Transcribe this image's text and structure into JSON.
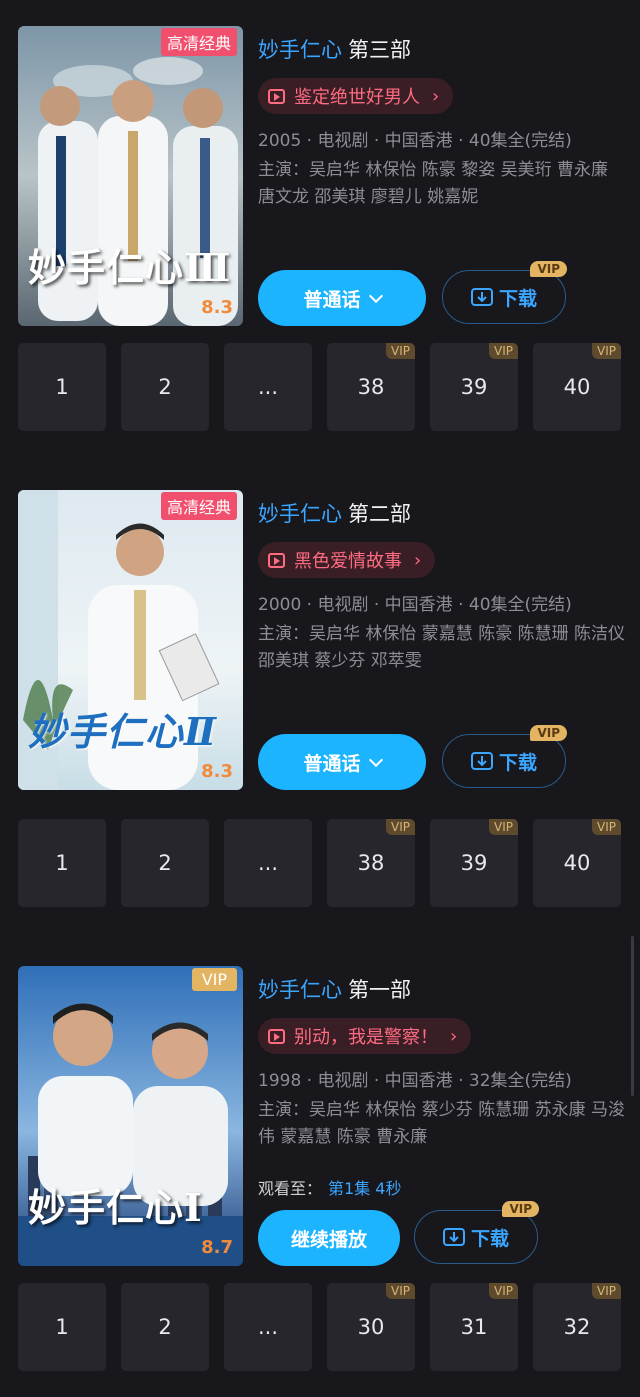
{
  "shows": [
    {
      "poster_badge": "高清经典",
      "poster_title": "妙手仁心Ⅲ",
      "poster_score": "8.3",
      "title_main": "妙手仁心",
      "title_part": "第三部",
      "tag_label": "鉴定绝世好男人",
      "meta": "2005 · 电视剧 · 中国香港 · 40集全(完结)",
      "cast_label": "主演：",
      "cast": "吴启华 林保怡 陈豪 黎姿 吴美珩 曹永廉 唐文龙 邵美琪 廖碧儿 姚嘉妮",
      "primary_label": "普通话",
      "download_label": "下载",
      "download_vip": "VIP",
      "episodes": [
        {
          "label": "1",
          "vip": ""
        },
        {
          "label": "2",
          "vip": ""
        },
        {
          "label": "...",
          "vip": ""
        },
        {
          "label": "38",
          "vip": "VIP"
        },
        {
          "label": "39",
          "vip": "VIP"
        },
        {
          "label": "40",
          "vip": "VIP"
        }
      ]
    },
    {
      "poster_badge": "高清经典",
      "poster_title": "妙手仁心Ⅱ",
      "poster_score": "8.3",
      "title_main": "妙手仁心",
      "title_part": "第二部",
      "tag_label": "黑色爱情故事",
      "meta": "2000 · 电视剧 · 中国香港 · 40集全(完结)",
      "cast_label": "主演：",
      "cast": "吴启华 林保怡 蒙嘉慧 陈豪 陈慧珊 陈洁仪 邵美琪 蔡少芬 邓萃雯",
      "primary_label": "普通话",
      "download_label": "下载",
      "download_vip": "VIP",
      "episodes": [
        {
          "label": "1",
          "vip": ""
        },
        {
          "label": "2",
          "vip": ""
        },
        {
          "label": "...",
          "vip": ""
        },
        {
          "label": "38",
          "vip": "VIP"
        },
        {
          "label": "39",
          "vip": "VIP"
        },
        {
          "label": "40",
          "vip": "VIP"
        }
      ]
    },
    {
      "poster_badge": "VIP",
      "poster_title": "妙手仁心Ⅰ",
      "poster_score": "8.7",
      "title_main": "妙手仁心",
      "title_part": "第一部",
      "tag_label": "别动，我是警察！",
      "meta": "1998 · 电视剧 · 中国香港 · 32集全(完结)",
      "cast_label": "主演：",
      "cast": "吴启华 林保怡 蔡少芬 陈慧珊 苏永康 马浚伟 蒙嘉慧 陈豪 曹永廉",
      "watch_label": "观看至：",
      "watch_progress": "第1集 4秒",
      "primary_label": "继续播放",
      "download_label": "下载",
      "download_vip": "VIP",
      "episodes": [
        {
          "label": "1",
          "vip": ""
        },
        {
          "label": "2",
          "vip": ""
        },
        {
          "label": "...",
          "vip": ""
        },
        {
          "label": "30",
          "vip": "VIP"
        },
        {
          "label": "31",
          "vip": "VIP"
        },
        {
          "label": "32",
          "vip": "VIP"
        }
      ]
    }
  ]
}
